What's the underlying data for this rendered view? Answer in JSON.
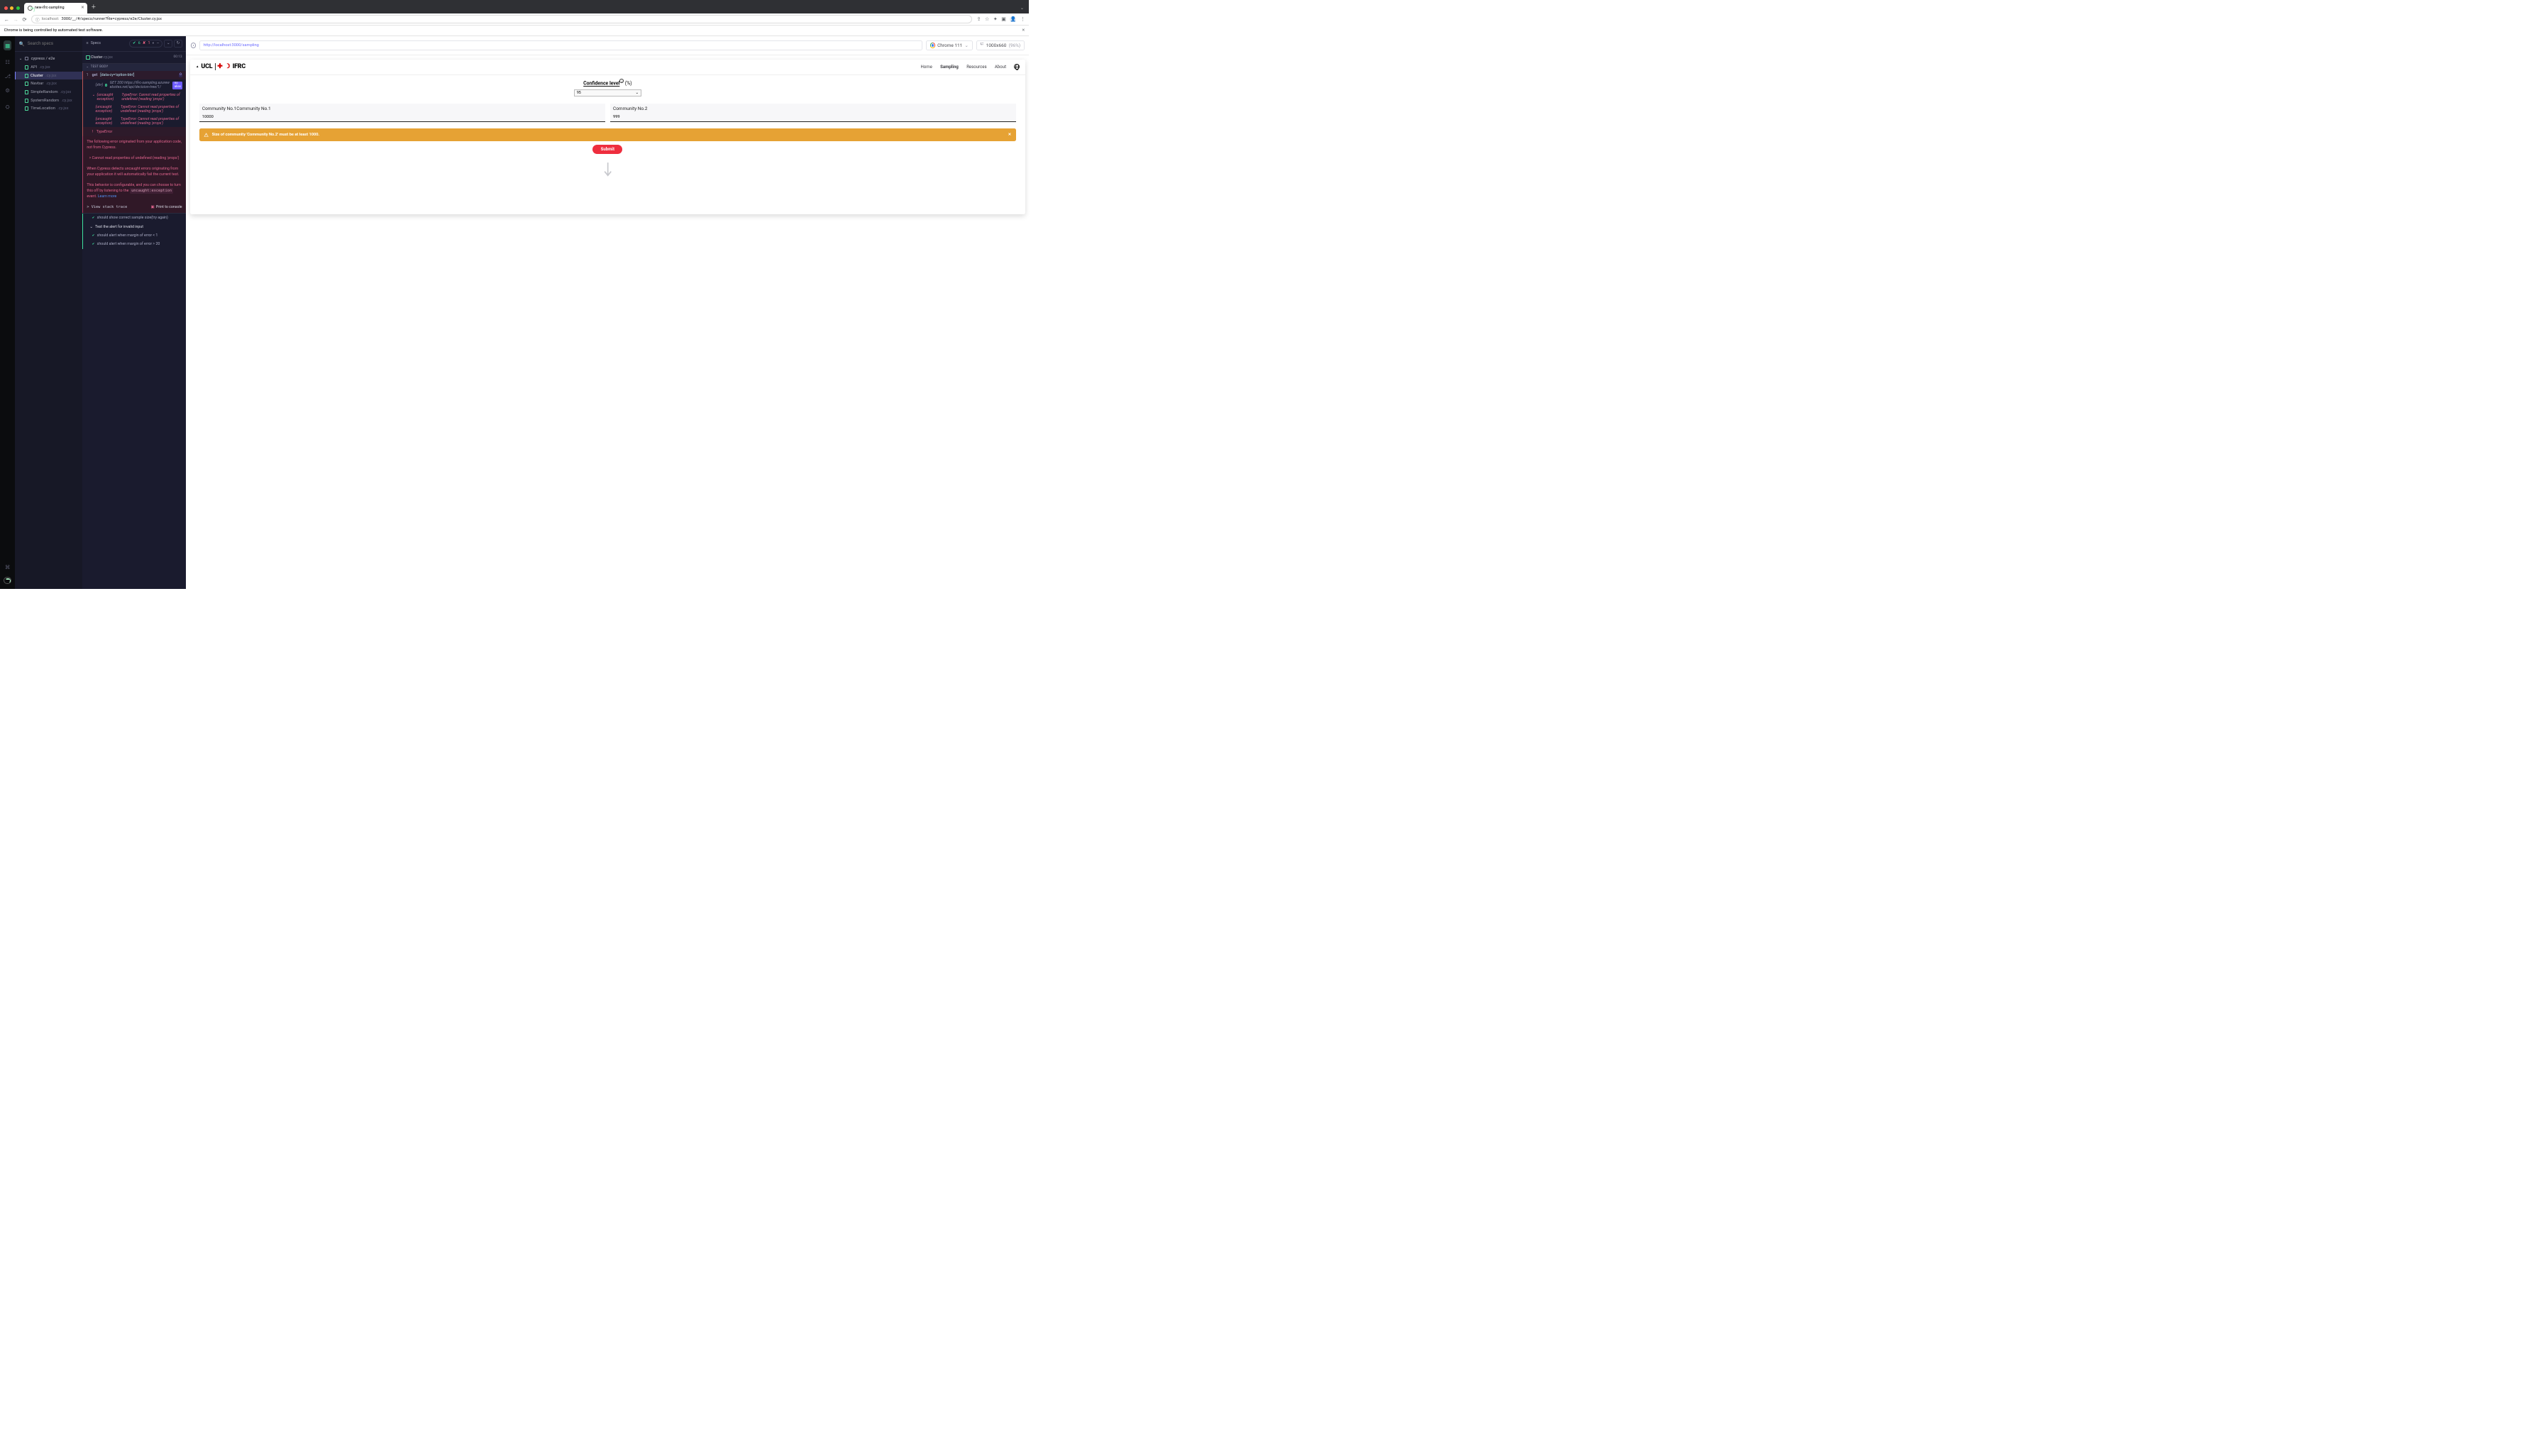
{
  "chrome": {
    "tab_title": "new-ifrc-sampling",
    "url_host": "localhost:",
    "url_rest": "3000/__/#/specs/runner?file=cypress/e2e/Cluster.cy.jsx",
    "banner": "Chrome is being controlled by automated test software."
  },
  "sidebar": {
    "search_placeholder": "Search specs",
    "dir": "cypress / e2e",
    "files": [
      {
        "name": "API",
        "ext": ".cy.jsx"
      },
      {
        "name": "Cluster",
        "ext": ".cy.jsx"
      },
      {
        "name": "Navbar",
        "ext": ".cy.jsx"
      },
      {
        "name": "SimpleRandom",
        "ext": ".cy.jsx"
      },
      {
        "name": "SystemRandom",
        "ext": ".cy.jsx"
      },
      {
        "name": "TimeLocation",
        "ext": ".cy.jsx"
      }
    ],
    "active_index": 1
  },
  "runner": {
    "header": "Specs",
    "pass": "6",
    "fail": "1",
    "pending": "--",
    "spec_name": "Cluster",
    "spec_ext": ".cy.jsx",
    "time": "00:13",
    "body_label": "TEST BODY",
    "cmd_no": "1",
    "cmd_kw": "get",
    "cmd_arg": "[data-cy='option-btn']",
    "cmd_count": "0",
    "xhr_prefix": "(xhr)",
    "xhr_line": "GET 200 https://ifrc-sampling.azurewebsites.net/api/decision-tree/1/",
    "xhr_alias": "no alias",
    "exc_prefix": "(uncaught exception)",
    "exc_msg": "TypeError: Cannot read properties of undefined (reading 'props')",
    "terr_icon": "!",
    "terr": "TypeError",
    "err_p1": "The following error originated from your application code, not from Cypress.",
    "err_q": "> Cannot read properties of undefined (reading 'props')",
    "err_p2": "When Cypress detects uncaught errors originating from your application it will automatically fail the current test.",
    "err_p3a": "This behavior is configurable, and you can choose to turn this off by listening to the ",
    "err_code": "uncaught:exception",
    "err_p3b": " event.  ",
    "err_learn": "Learn more",
    "trace": "> View stack trace",
    "print": "Print to console",
    "tests": [
      {
        "type": "pass",
        "label": "should show correct sample size(try again)"
      },
      {
        "type": "describe",
        "label": "Test the alert for invalid input"
      },
      {
        "type": "pass",
        "label": "should alert when margin of error < 1"
      },
      {
        "type": "pass",
        "label": "should alert when margin of error > 20"
      }
    ]
  },
  "aut": {
    "url": "http://localhost:3000/sampling",
    "browser": "Chrome 111",
    "viewport": "1000x660",
    "scale": "(96%)",
    "logo_ucl": "UCL",
    "logo_ifrc": "IFRC",
    "menu": [
      "Home",
      "Sampling",
      "Resources",
      "About"
    ],
    "menu_active": 1,
    "conf_label": "Confidence level",
    "conf_unit": "(%)",
    "conf_value": "95",
    "cells": [
      {
        "label": "Community No.1Community No.1",
        "value": "10000"
      },
      {
        "label": "Community No.2",
        "value": "999"
      }
    ],
    "alert": "Size of community 'Community No.2' must be at least 1000.",
    "submit": "Submit"
  }
}
